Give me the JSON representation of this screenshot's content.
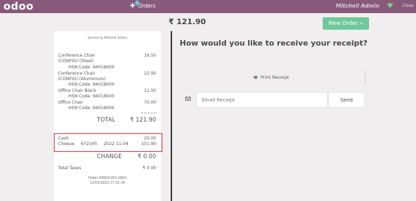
{
  "topbar": {
    "logo": "odoo",
    "orders_label": "Orders",
    "orders_count": "1",
    "user": "Mitchell Admin",
    "close_label": "Close"
  },
  "header": {
    "total": "₹ 121.90",
    "new_order_label": "New Order »"
  },
  "receipt": {
    "served_by": "Served by Mitchell Admin",
    "lines": [
      {
        "name": "Conference Chair",
        "amount": "16.50"
      },
      {
        "name": "(CONFIG) (Steel)",
        "amount": ""
      },
      {
        "name": "Conference Chair",
        "amount": "22.90"
      },
      {
        "name": "(CONFIG) (Aluminium)",
        "amount": ""
      },
      {
        "name": "Office Chair Black",
        "amount": "12.50"
      },
      {
        "name": "Office Chair",
        "amount": "70.00"
      }
    ],
    "hsn": [
      "HSN Code: 94018000",
      "HSN Code: 94018000",
      "HSN Code: 94018000",
      "HSN Code: 94018000"
    ],
    "total_label": "TOTAL",
    "total_value": "₹ 121.90",
    "payments": [
      {
        "method": "Cash",
        "ref": "",
        "date": "",
        "amount": "20.00"
      },
      {
        "method": "Cheque",
        "ref": "672165",
        "date": "2022-11-04",
        "amount": "101.90"
      }
    ],
    "change_label": "CHANGE",
    "change_value": "₹ 0.00",
    "taxes_label": "Total Taxes",
    "taxes_value": "₹ 0.00",
    "order_ref": "Order 00004-001-0002",
    "order_datetime": "11/03/2022 17:21:34"
  },
  "panel": {
    "question": "How would you like to receive your receipt?",
    "print_label": "Print Receipt",
    "email_placeholder": "Email Receipt",
    "send_label": "Send"
  },
  "colors": {
    "topbar": "#875a7b",
    "new_order": "#6ec89b",
    "highlight": "#d9323a"
  }
}
